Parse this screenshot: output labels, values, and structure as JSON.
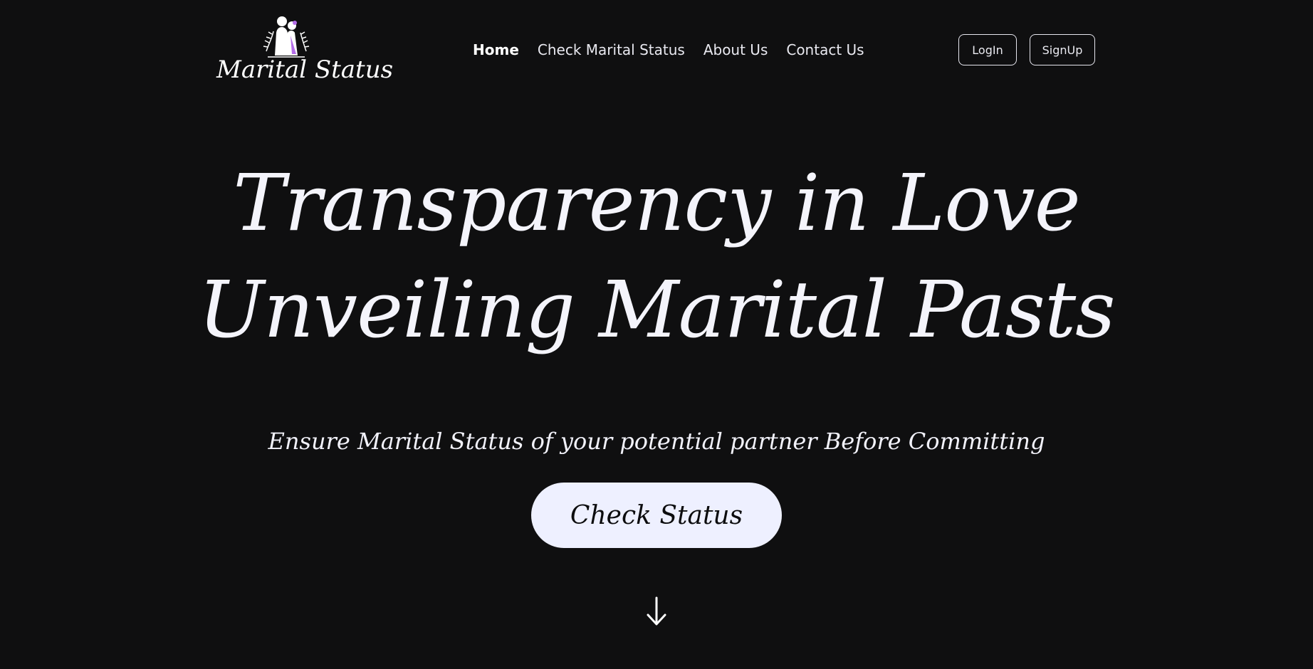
{
  "brand": {
    "logo_text": "Marital Status",
    "accent_color": "#b36ce8"
  },
  "nav": {
    "items": [
      {
        "label": "Home",
        "active": true
      },
      {
        "label": "Check Marital Status",
        "active": false
      },
      {
        "label": "About Us",
        "active": false
      },
      {
        "label": "Contact Us",
        "active": false
      }
    ]
  },
  "auth": {
    "login_label": "LogIn",
    "signup_label": "SignUp"
  },
  "hero": {
    "title_line_1": "Transparency in Love",
    "title_line_2": "Unveiling Marital Pasts",
    "subtitle": "Ensure Marital Status of your potential partner Before Committing",
    "cta_label": "Check Status",
    "scroll_icon": "arrow-down-icon"
  },
  "colors": {
    "background": "#0f0f10",
    "text": "#f2f2f7",
    "cta_background": "#eef0ff",
    "cta_text": "#0c0c0e"
  }
}
